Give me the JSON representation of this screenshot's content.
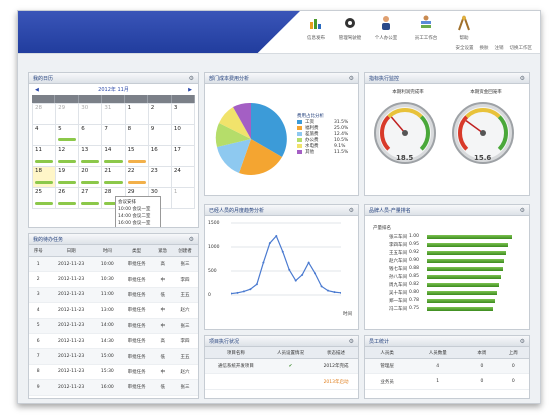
{
  "nav": [
    {
      "label": "信息发布",
      "icon": "chart-icon"
    },
    {
      "label": "管理驾驶舱",
      "icon": "gear-icon"
    },
    {
      "label": "个人办公室",
      "icon": "user-icon"
    },
    {
      "label": "员工工作台",
      "icon": "stack-icon"
    },
    {
      "label": "帮助",
      "icon": "compass-icon"
    }
  ],
  "toplinks": [
    "安全设置",
    "换肤",
    "注销",
    "切换工作区"
  ],
  "calendar": {
    "title": "我的日历",
    "month_label": "2012年 11月",
    "prev": "◀",
    "next": "▶",
    "days": [
      "28",
      "29",
      "30",
      "31",
      "1",
      "2",
      "3",
      "4",
      "5",
      "6",
      "7",
      "8",
      "9",
      "10",
      "11",
      "12",
      "13",
      "14",
      "15",
      "16",
      "17",
      "18",
      "19",
      "20",
      "21",
      "22",
      "23",
      "24",
      "25",
      "26",
      "27",
      "28",
      "29",
      "30",
      "1"
    ],
    "popup_title": "会议安排",
    "popup_lines": [
      "10:00 会议一室",
      "14:00 会议二室",
      "16:00 会议一室"
    ]
  },
  "pie_panel": {
    "title": "部门成本费用分析",
    "legend_title": "费用占比分析",
    "legend": [
      {
        "label": "工资",
        "value": "31.5%",
        "color": "#3c9bd8"
      },
      {
        "label": "福利费",
        "value": "25.0%",
        "color": "#f4a531"
      },
      {
        "label": "差旅费",
        "value": "12.4%",
        "color": "#8ec9f0"
      },
      {
        "label": "办公费",
        "value": "10.5%",
        "color": "#b5dd6a"
      },
      {
        "label": "水电费",
        "value": "9.1%",
        "color": "#f1e36b"
      },
      {
        "label": "其他",
        "value": "11.5%",
        "color": "#a45fc4"
      }
    ]
  },
  "gauge_panel": {
    "title": "指标执行监控",
    "gauges": [
      {
        "title": "本期利润完成率",
        "value": "18.5",
        "needle": 0.35
      },
      {
        "title": "本期资金回笼率",
        "value": "15.6",
        "needle": 0.3
      }
    ]
  },
  "todo": {
    "title": "我的待办任务",
    "columns": [
      "序号",
      "日期",
      "时间",
      "类型",
      "紧急",
      "创建者"
    ],
    "rows": [
      [
        "1",
        "2012-11-23",
        "10:00",
        "审批任务",
        "高",
        "张三"
      ],
      [
        "2",
        "2012-11-23",
        "10:30",
        "审批任务",
        "中",
        "李四"
      ],
      [
        "3",
        "2012-11-23",
        "11:00",
        "审批任务",
        "低",
        "王五"
      ],
      [
        "4",
        "2012-11-23",
        "13:00",
        "审批任务",
        "中",
        "赵六"
      ],
      [
        "5",
        "2012-11-23",
        "14:00",
        "审批任务",
        "中",
        "张三"
      ],
      [
        "6",
        "2012-11-23",
        "14:30",
        "审批任务",
        "高",
        "李四"
      ],
      [
        "7",
        "2012-11-23",
        "15:00",
        "审批任务",
        "低",
        "王五"
      ],
      [
        "8",
        "2012-11-23",
        "15:30",
        "审批任务",
        "中",
        "赵六"
      ],
      [
        "9",
        "2012-11-23",
        "16:00",
        "审批任务",
        "低",
        "张三"
      ],
      [
        "10",
        "2012-11-23",
        "16:30",
        "审批任务",
        "中",
        "李四"
      ]
    ]
  },
  "line_panel": {
    "title": "已经人员的月度趋势分析",
    "y_ticks": [
      "1500",
      "1000",
      "500",
      "0"
    ],
    "x_label": "时间",
    "points": [
      0.02,
      0.03,
      0.05,
      0.08,
      0.15,
      0.45,
      0.72,
      0.82,
      0.6,
      0.35,
      0.2,
      0.28,
      0.45,
      0.3,
      0.12,
      0.06,
      0.04,
      0.03
    ]
  },
  "bar_panel": {
    "title": "品牌人员-产量排名",
    "subtitle": "产量排名",
    "rows": [
      {
        "label": "张三车间",
        "value": "1.00",
        "pct": 0.92
      },
      {
        "label": "李四车间",
        "value": "0.95",
        "pct": 0.88
      },
      {
        "label": "王五车间",
        "value": "0.92",
        "pct": 0.86
      },
      {
        "label": "赵六车间",
        "value": "0.90",
        "pct": 0.84
      },
      {
        "label": "钱七车间",
        "value": "0.88",
        "pct": 0.83
      },
      {
        "label": "孙八车间",
        "value": "0.85",
        "pct": 0.8
      },
      {
        "label": "周九车间",
        "value": "0.82",
        "pct": 0.78
      },
      {
        "label": "吴十车间",
        "value": "0.80",
        "pct": 0.76
      },
      {
        "label": "郑一车间",
        "value": "0.78",
        "pct": 0.74
      },
      {
        "label": "冯二车间",
        "value": "0.75",
        "pct": 0.72
      }
    ]
  },
  "project_panel": {
    "title": "项目执行状况",
    "columns": [
      "项目名称",
      "人员设置情况",
      "状态描述"
    ],
    "rows": [
      {
        "name": "通信系统开发项目",
        "status": "✔",
        "desc": "2012年完成"
      },
      {
        "name": "",
        "status": "",
        "desc": "2013年启动"
      }
    ]
  },
  "stats_panel": {
    "title": "员工统计",
    "columns": [
      "人员类",
      "人员数量",
      "本周",
      "上周"
    ],
    "rows": [
      [
        "管理层",
        "4",
        "0",
        "0"
      ],
      [
        "业务员",
        "1",
        "0",
        "0"
      ]
    ]
  }
}
